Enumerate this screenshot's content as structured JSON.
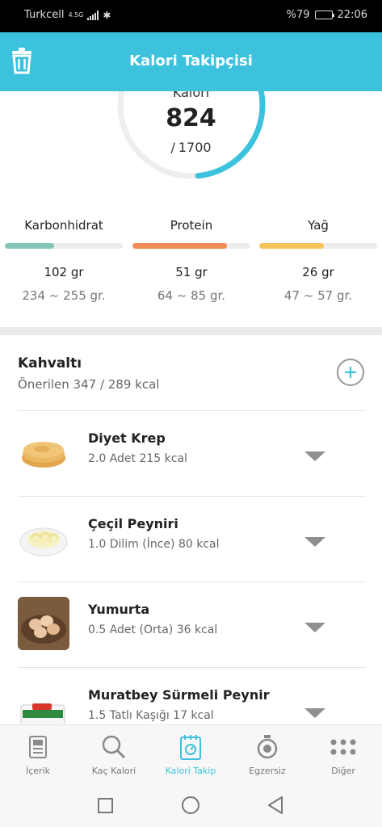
{
  "status_bar": {
    "carrier": "Turkcell",
    "network": "4.5G",
    "battery": "%79",
    "time": "22:06"
  },
  "header": {
    "title": "Kalori Takipçisi"
  },
  "ring": {
    "label": "Kalori",
    "value": "824",
    "goal": "1700",
    "progress": 0.485,
    "color": "#3cc2dd"
  },
  "macros": [
    {
      "name": "Karbonhidrat",
      "amount": "102 gr",
      "range": "234 ~ 255 gr.",
      "progress": 0.42,
      "color": "#86c6b7"
    },
    {
      "name": "Protein",
      "amount": "51 gr",
      "range": "64 ~ 85 gr.",
      "progress": 0.8,
      "color": "#f08c55"
    },
    {
      "name": "Yağ",
      "amount": "26 gr",
      "range": "47 ~ 57 gr.",
      "progress": 0.55,
      "color": "#f6c559"
    }
  ],
  "meal": {
    "title": "Kahvaltı",
    "subtitle": "Önerilen 347 / 289 kcal",
    "items": [
      {
        "name": "Diyet Krep",
        "detail": "2.0 Adet 215 kcal"
      },
      {
        "name": "Çeçil Peyniri",
        "detail": "1.0 Dilim (İnce) 80 kcal"
      },
      {
        "name": "Yumurta",
        "detail": "0.5 Adet (Orta) 36 kcal"
      },
      {
        "name": "Muratbey Sürmeli Peynir",
        "detail": "1.5 Tatlı Kaşığı 17 kcal"
      }
    ]
  },
  "bottom_nav": [
    {
      "label": "İçerik",
      "icon": "document-icon"
    },
    {
      "label": "Kaç Kalori",
      "icon": "search-icon"
    },
    {
      "label": "Kalori Takip",
      "icon": "calendar-icon",
      "active": true
    },
    {
      "label": "Egzersiz",
      "icon": "stopwatch-icon"
    },
    {
      "label": "Diğer",
      "icon": "more-icon"
    }
  ],
  "colors": {
    "accent": "#3cc2dd",
    "inactive": "#8a8a8a"
  }
}
